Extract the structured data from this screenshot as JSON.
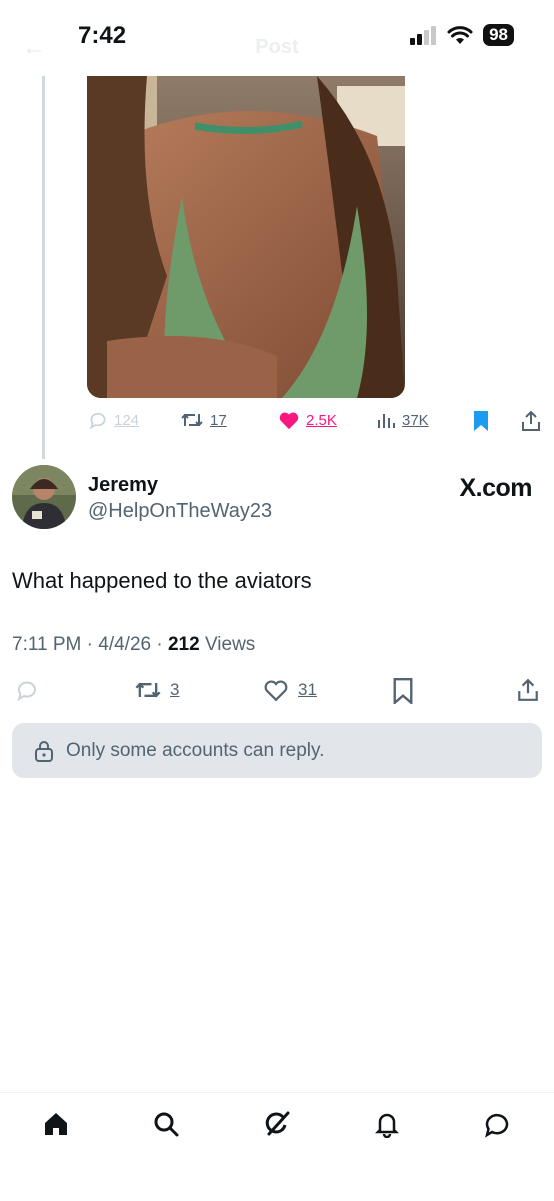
{
  "status_bar": {
    "time": "7:42",
    "battery": "98"
  },
  "header": {
    "back_icon": "arrow-left-icon",
    "title": "Post"
  },
  "quoted_post": {
    "image_alt": "photo",
    "actions": {
      "replies": "124",
      "reposts": "17",
      "likes": "2.5K",
      "views": "37K"
    },
    "colors": {
      "like": "#f91880",
      "bookmark": "#1d9bf0",
      "muted": "#c9d3da",
      "text": "#536471"
    }
  },
  "author": {
    "name": "Jeremy",
    "handle": "@HelpOnTheWay23",
    "watermark": "X.com"
  },
  "tweet": {
    "text": "What happened to the aviators",
    "time": "7:11 PM",
    "date": "4/4/26",
    "sep": "·",
    "views_count": "212",
    "views_label": "Views"
  },
  "actions": {
    "reposts": "3",
    "likes": "31"
  },
  "reply_restriction": {
    "text": "Only some accounts can reply."
  },
  "tab_bar": {
    "items": [
      "home-icon",
      "search-icon",
      "grok-icon",
      "notifications-icon",
      "messages-icon"
    ]
  }
}
